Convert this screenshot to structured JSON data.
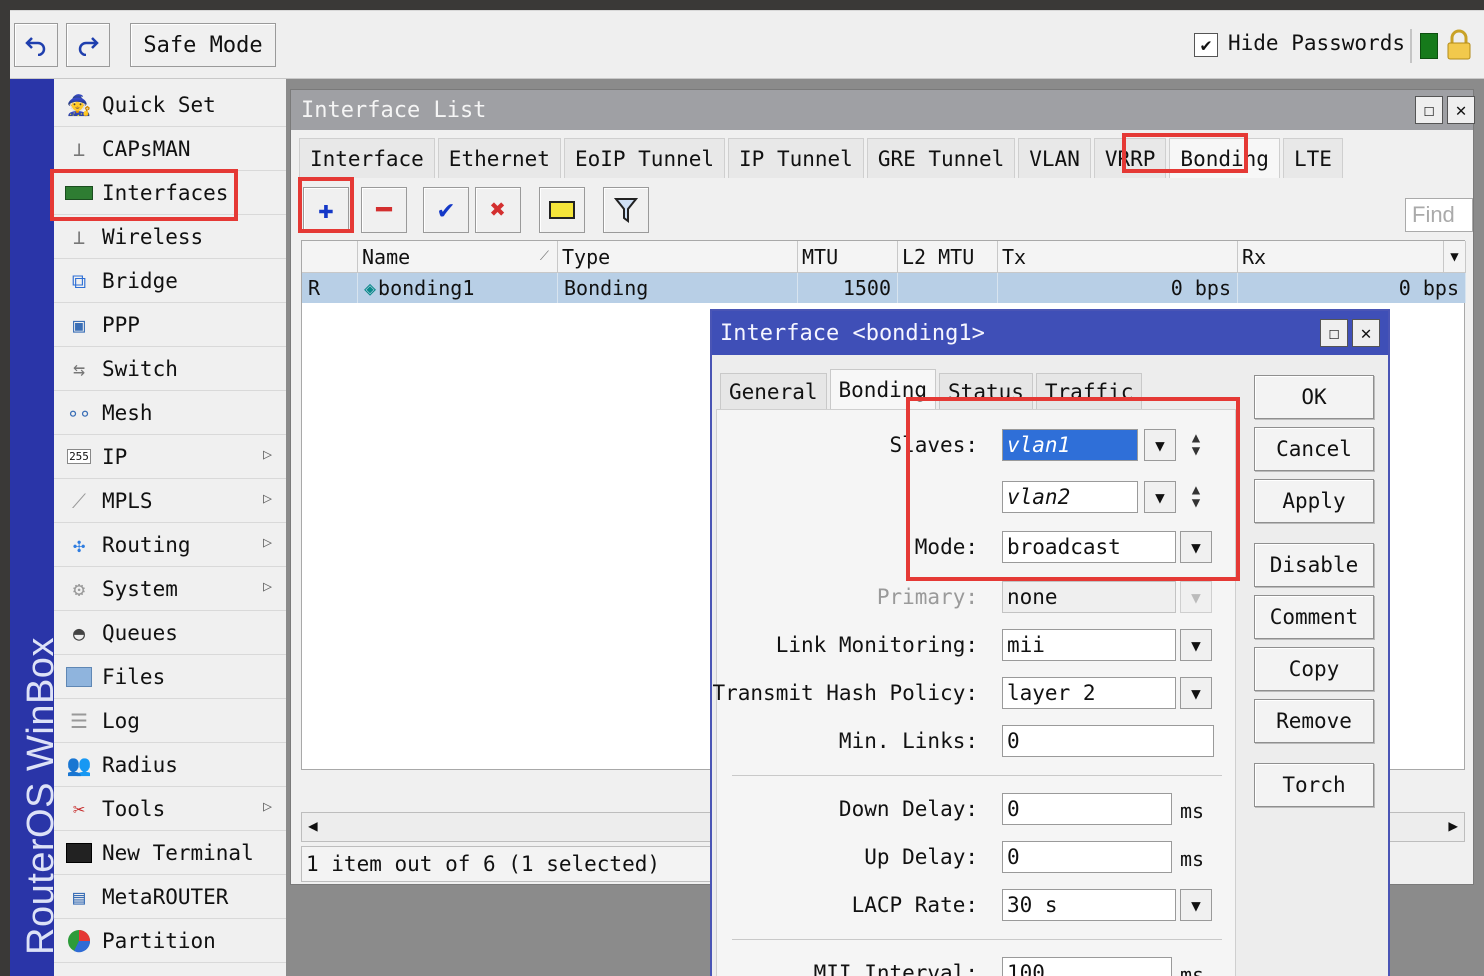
{
  "toolbar": {
    "undo_icon": "undo-arrow",
    "redo_icon": "redo-arrow",
    "safe_mode": "Safe Mode",
    "hide_passwords": "Hide Passwords",
    "hide_passwords_checked": true
  },
  "brand": "RouterOS WinBox",
  "sidebar": {
    "items": [
      {
        "label": "Quick Set",
        "icon": "quick-set-icon",
        "submenu": false
      },
      {
        "label": "CAPsMAN",
        "icon": "antenna-icon",
        "submenu": false
      },
      {
        "label": "Interfaces",
        "icon": "interfaces-icon",
        "submenu": false
      },
      {
        "label": "Wireless",
        "icon": "wireless-icon",
        "submenu": false
      },
      {
        "label": "Bridge",
        "icon": "bridge-icon",
        "submenu": false
      },
      {
        "label": "PPP",
        "icon": "ppp-icon",
        "submenu": false
      },
      {
        "label": "Switch",
        "icon": "switch-icon",
        "submenu": false
      },
      {
        "label": "Mesh",
        "icon": "mesh-icon",
        "submenu": false
      },
      {
        "label": "IP",
        "icon": "ip-icon",
        "submenu": true
      },
      {
        "label": "MPLS",
        "icon": "mpls-icon",
        "submenu": true
      },
      {
        "label": "Routing",
        "icon": "routing-icon",
        "submenu": true
      },
      {
        "label": "System",
        "icon": "system-icon",
        "submenu": true
      },
      {
        "label": "Queues",
        "icon": "queues-icon",
        "submenu": false
      },
      {
        "label": "Files",
        "icon": "files-icon",
        "submenu": false
      },
      {
        "label": "Log",
        "icon": "log-icon",
        "submenu": false
      },
      {
        "label": "Radius",
        "icon": "radius-icon",
        "submenu": false
      },
      {
        "label": "Tools",
        "icon": "tools-icon",
        "submenu": true
      },
      {
        "label": "New Terminal",
        "icon": "terminal-icon",
        "submenu": false
      },
      {
        "label": "MetaROUTER",
        "icon": "metarouter-icon",
        "submenu": false
      },
      {
        "label": "Partition",
        "icon": "partition-icon",
        "submenu": false
      }
    ],
    "ip_badge": "255"
  },
  "interface_list": {
    "title": "Interface List",
    "tabs": [
      "Interface",
      "Ethernet",
      "EoIP Tunnel",
      "IP Tunnel",
      "GRE Tunnel",
      "VLAN",
      "VRRP",
      "Bonding",
      "LTE"
    ],
    "active_tab": "Bonding",
    "find_placeholder": "Find",
    "columns": [
      "",
      "Name",
      "Type",
      "MTU",
      "L2 MTU",
      "Tx",
      "Rx"
    ],
    "rows": [
      {
        "flag": "R",
        "name": "bonding1",
        "type": "Bonding",
        "mtu": "1500",
        "l2mtu": "",
        "tx": "0 bps",
        "rx": "0 bps"
      }
    ],
    "status": "1 item out of 6 (1 selected)"
  },
  "dialog": {
    "title": "Interface <bonding1>",
    "tabs": [
      "General",
      "Bonding",
      "Status",
      "Traffic"
    ],
    "active_tab": "Bonding",
    "fields": {
      "slaves_label": "Slaves:",
      "slave1": "vlan1",
      "slave2": "vlan2",
      "mode_label": "Mode:",
      "mode": "broadcast",
      "primary_label": "Primary:",
      "primary": "none",
      "link_monitoring_label": "Link Monitoring:",
      "link_monitoring": "mii",
      "hash_policy_label": "Transmit Hash Policy:",
      "hash_policy": "layer 2",
      "min_links_label": "Min. Links:",
      "min_links": "0",
      "down_delay_label": "Down Delay:",
      "down_delay": "0",
      "up_delay_label": "Up Delay:",
      "up_delay": "0",
      "lacp_rate_label": "LACP Rate:",
      "lacp_rate": "30 s",
      "mii_interval_label": "MII Interval:",
      "mii_interval": "100",
      "unit_ms": "ms"
    },
    "buttons": [
      "OK",
      "Cancel",
      "Apply",
      "Disable",
      "Comment",
      "Copy",
      "Remove",
      "Torch"
    ]
  },
  "colors": {
    "highlight": "#e53935",
    "sideband": "#2a35a8",
    "dialog_title": "#3f4fb7",
    "selected_row": "#b8cfe6"
  }
}
